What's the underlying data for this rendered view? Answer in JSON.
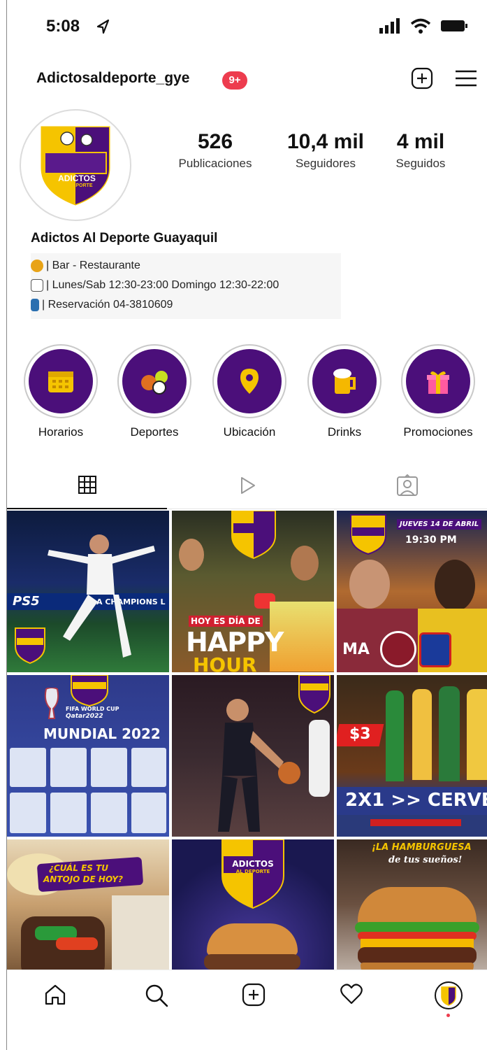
{
  "status_bar": {
    "time": "5:08"
  },
  "header": {
    "username": "Adictosaldeporte_gye",
    "notifications": "9+"
  },
  "profile": {
    "logo_top": "ADICTOS",
    "logo_bottom": "AL DEPORTE",
    "stats": [
      {
        "value": "526",
        "label": "Publicaciones"
      },
      {
        "value": "10,4 mil",
        "label": "Seguidores"
      },
      {
        "value": "4 mil",
        "label": "Seguidos"
      }
    ]
  },
  "bio": {
    "name": "Adictos Al Deporte Guayaquil",
    "lines": [
      "| Bar - Restaurante",
      "| Lunes/Sab 12:30-23:00 Domingo 12:30-22:00",
      "| Reservación 04-3810609"
    ]
  },
  "highlights": [
    {
      "label": "Horarios",
      "icon": "calendar-icon"
    },
    {
      "label": "Deportes",
      "icon": "sports-balls-icon"
    },
    {
      "label": "Ubicación",
      "icon": "location-pin-icon"
    },
    {
      "label": "Drinks",
      "icon": "beer-mug-icon"
    },
    {
      "label": "Promociones",
      "icon": "gift-icon"
    }
  ],
  "posts": {
    "p1_text": "PS5",
    "p1_text2": "A CHAMPIONS L",
    "p2_text1": "HOY ES DÍA DE",
    "p2_text2": "HAPPY",
    "p2_text3": "HOUR",
    "p3_text1": "JUEVES 14 DE ABRIL",
    "p3_text2": "19:30 PM",
    "p3_text3": "MA",
    "p4_text1": "FIFA WORLD CUP",
    "p4_text2": "Qatar2022",
    "p4_text3": "MUNDIAL 2022",
    "p6_text1": "$3",
    "p6_text2": "2X1  >> CERVEZ",
    "p7_text1": "¿CUÁL ES TU",
    "p7_text2": "ANTOJO DE HOY?",
    "p8_text1": "ADICTOS",
    "p8_text2": "AL DEPORTE",
    "p9_text1": "¡LA HAMBURGUESA",
    "p9_text2": "de tus sueños!"
  },
  "colors": {
    "brand_purple": "#4b0f7a",
    "brand_yellow": "#f5c400",
    "badge_red": "#ed3c4e"
  }
}
